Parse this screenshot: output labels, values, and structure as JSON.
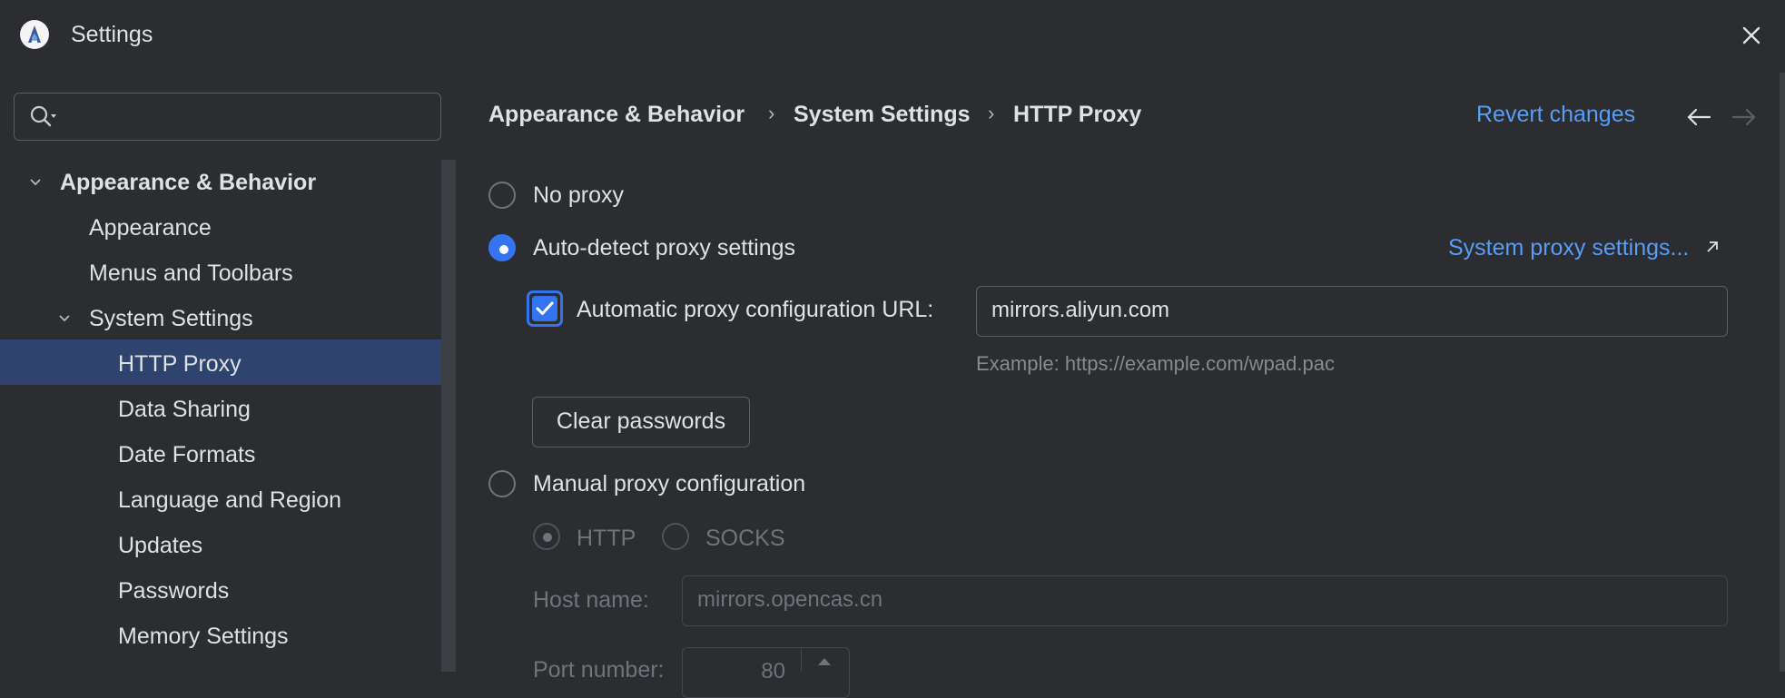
{
  "window": {
    "title": "Settings"
  },
  "search": {
    "placeholder": ""
  },
  "sidebar": {
    "items": [
      {
        "label": "Appearance & Behavior"
      },
      {
        "label": "Appearance"
      },
      {
        "label": "Menus and Toolbars"
      },
      {
        "label": "System Settings"
      },
      {
        "label": "HTTP Proxy"
      },
      {
        "label": "Data Sharing"
      },
      {
        "label": "Date Formats"
      },
      {
        "label": "Language and Region"
      },
      {
        "label": "Updates"
      },
      {
        "label": "Passwords"
      },
      {
        "label": "Memory Settings"
      }
    ]
  },
  "breadcrumb": [
    "Appearance & Behavior",
    "System Settings",
    "HTTP Proxy"
  ],
  "header": {
    "revert": "Revert changes",
    "back_icon": "arrow-left-icon",
    "forward_icon": "arrow-right-icon"
  },
  "proxy": {
    "no_proxy": "No proxy",
    "auto_detect": "Auto-detect proxy settings",
    "system_link": "System proxy settings...",
    "auto_url_label": "Automatic proxy configuration URL:",
    "auto_url_value": "mirrors.aliyun.com",
    "auto_url_hint": "Example: https://example.com/wpad.pac",
    "clear_passwords": "Clear passwords",
    "manual": "Manual proxy configuration",
    "http": "HTTP",
    "socks": "SOCKS",
    "host_label": "Host name:",
    "host_value": "mirrors.opencas.cn",
    "port_label": "Port number:",
    "port_value": "80"
  },
  "colors": {
    "accent": "#3574f0",
    "link": "#589df6",
    "selection": "#2e436e",
    "background": "#2b2d30"
  }
}
